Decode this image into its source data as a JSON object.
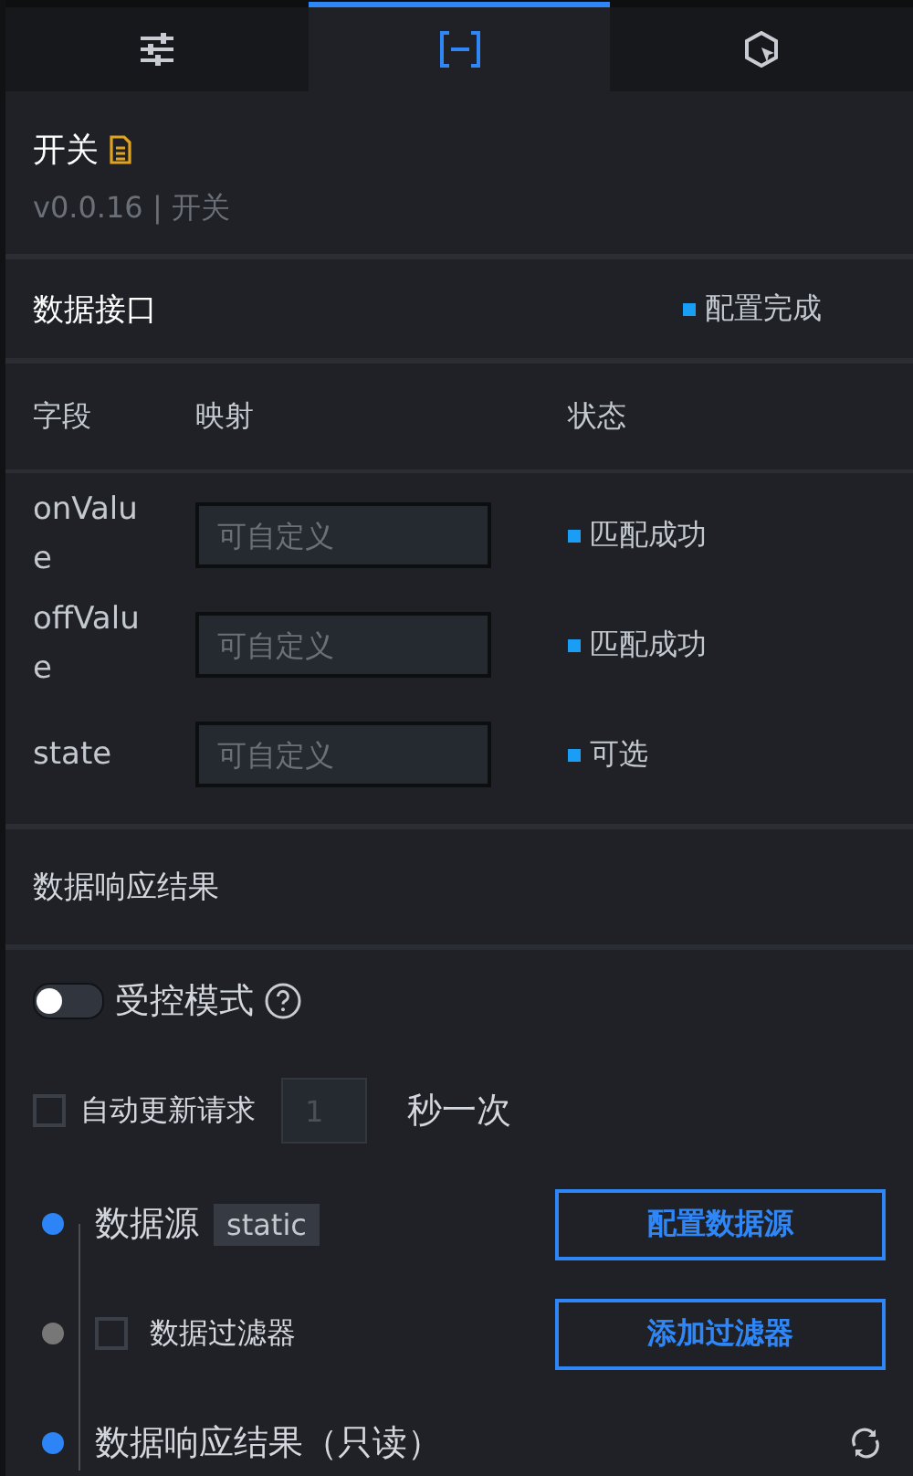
{
  "tabs": [
    {
      "kind": "sliders",
      "selected": false
    },
    {
      "kind": "brackets",
      "selected": true
    },
    {
      "kind": "cursor",
      "selected": false
    }
  ],
  "component": {
    "title": "开关",
    "version": "v0.0.16 | 开关"
  },
  "data_interface": {
    "title": "数据接口",
    "status": "配置完成"
  },
  "mapping_table": {
    "columns": [
      "字段",
      "映射",
      "状态"
    ],
    "rows": [
      {
        "field": "onValue",
        "placeholder": "可自定义",
        "status": "匹配成功"
      },
      {
        "field": "offValue",
        "placeholder": "可自定义",
        "status": "匹配成功"
      },
      {
        "field": "state",
        "placeholder": "可自定义",
        "status": "可选"
      }
    ]
  },
  "response": {
    "title": "数据响应结果"
  },
  "controlled_mode": {
    "label": "受控模式",
    "on": false
  },
  "auto_update": {
    "label": "自动更新请求",
    "checked": false,
    "value": "1",
    "unit": "秒一次"
  },
  "steps": [
    {
      "kind": "source",
      "active": true,
      "label": "数据源",
      "tag": "static",
      "button": "配置数据源"
    },
    {
      "kind": "filter",
      "active": false,
      "checked": false,
      "label": "数据过滤器",
      "button": "添加过滤器"
    },
    {
      "kind": "result",
      "active": true,
      "label": "数据响应结果（只读）"
    }
  ]
}
